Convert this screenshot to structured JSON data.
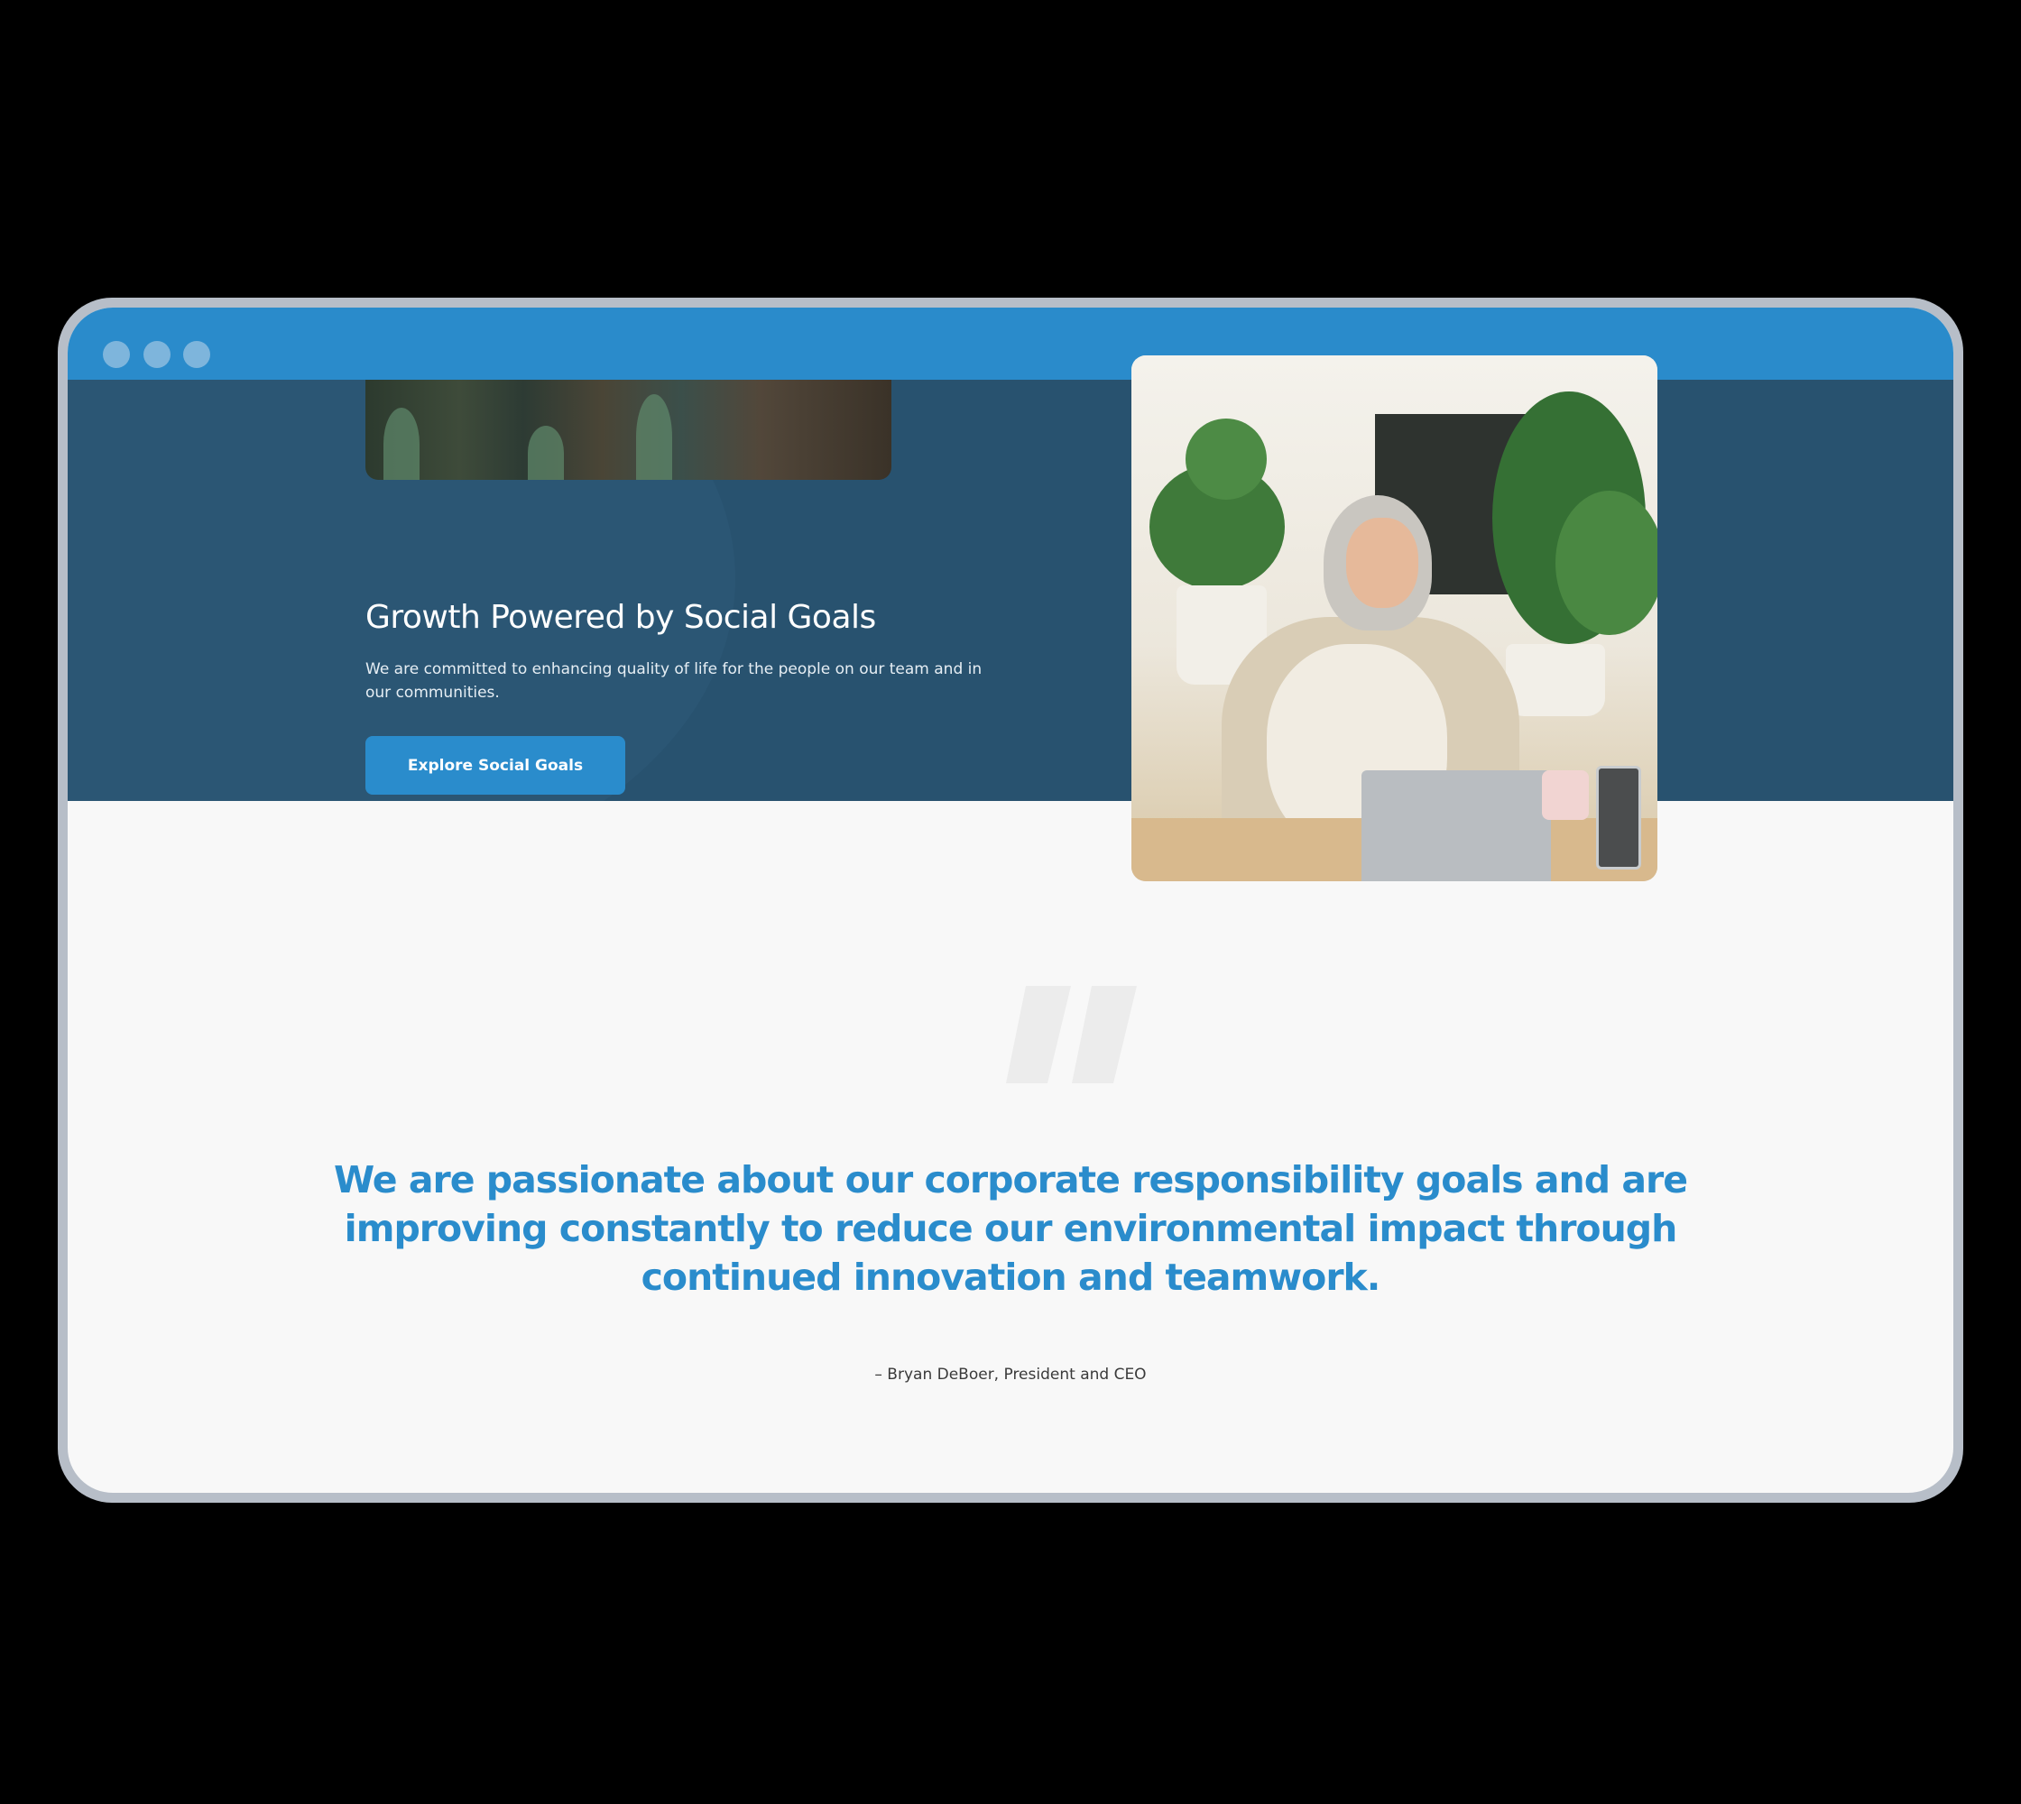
{
  "window": {
    "controls": [
      "window-dot-1",
      "window-dot-2",
      "window-dot-3"
    ]
  },
  "hero": {
    "title": "Growth Powered by Social Goals",
    "description": "We are committed to enhancing quality of life for the people on our team and in our communities.",
    "button_label": "Explore Social Goals"
  },
  "quote": {
    "mark_icon": "quote-mark-icon",
    "text": "We are passionate about our corporate responsibility goals and are improving constantly to reduce our environmental impact through continued innovation and teamwork.",
    "author": "– Bryan DeBoer, President and CEO"
  },
  "colors": {
    "titlebar": "#2a8bcb",
    "hero_bg": "#28526f",
    "accent": "#2a8ccc",
    "page_bg": "#f8f8f8"
  }
}
